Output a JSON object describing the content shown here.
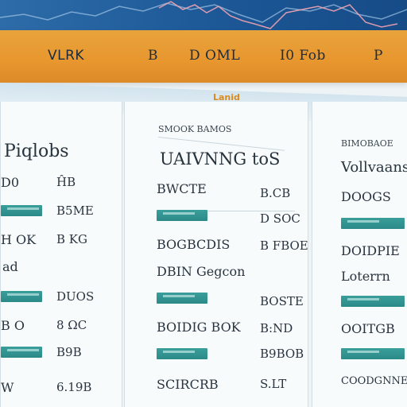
{
  "header": {
    "logo": "VLRK",
    "nav": [
      "B",
      "D OML",
      "I0 Fob",
      "P"
    ]
  },
  "subheader": {
    "label": "Lanid"
  },
  "columns": [
    {
      "title": "Piqlobs",
      "rows": [
        {
          "left": "D0",
          "right": "ĤB"
        },
        {
          "left": "",
          "right": "B5ME"
        },
        {
          "left": "H OK",
          "right": "B KG"
        },
        {
          "left": "ad",
          "right": ""
        },
        {
          "left": "",
          "right": "DUOS"
        },
        {
          "left": "B O",
          "right": "8 ΩC"
        },
        {
          "left": "",
          "right": "B9B"
        },
        {
          "left": "W",
          "right": "6.19B"
        }
      ]
    },
    {
      "caption": "SMOOK BAMOS",
      "title": "UAIVNNG toS",
      "rows": [
        {
          "left": "BWCTE",
          "right": "B.CB"
        },
        {
          "left": "",
          "right": "D SOC"
        },
        {
          "left": "BOGBCDIS",
          "right": "B FBOE"
        },
        {
          "left": "DBIN Gegcon",
          "right": ""
        },
        {
          "left": "",
          "right": "BOSTE"
        },
        {
          "left": "BOIDIG BOK",
          "right": "B:ND"
        },
        {
          "left": "",
          "right": "B9BOB"
        },
        {
          "left": "SCIRCRB",
          "right": "S.LT"
        }
      ]
    },
    {
      "caption": "BIMOBAOE",
      "title": "Vollvaanse",
      "rows": [
        {
          "left": "DOOGS"
        },
        {
          "left": ""
        },
        {
          "left": "DOIDPIE"
        },
        {
          "left": "Loterrn"
        },
        {
          "left": ""
        },
        {
          "left": "OOITGB"
        },
        {
          "left": ""
        },
        {
          "left": "COODGNNE"
        }
      ]
    }
  ],
  "colors": {
    "teal": "#2b8a88",
    "orange": "#e8962e",
    "blue": "#1c5796"
  }
}
